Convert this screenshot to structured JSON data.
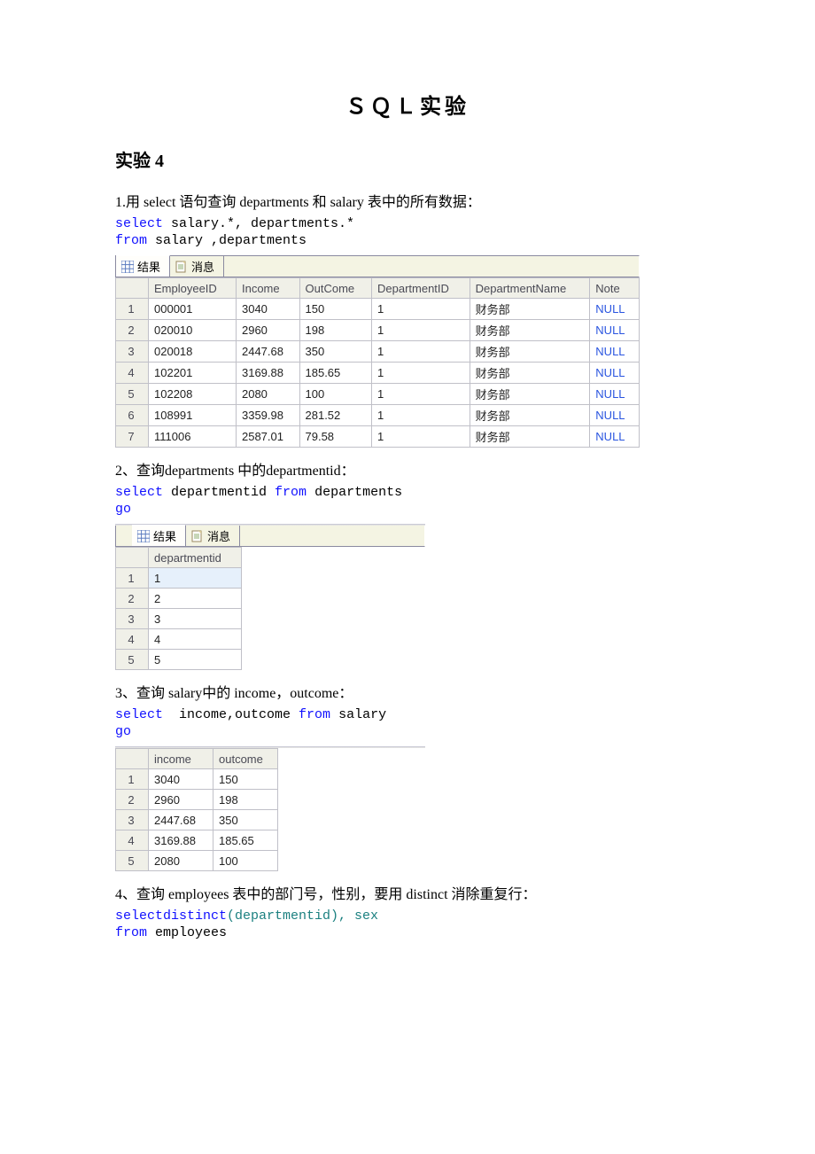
{
  "title": "ＳＱＬ实验",
  "section_heading": "实验 4",
  "q1": {
    "prompt": "1.用 select 语句查询 departments 和 salary 表中的所有数据：",
    "code_line1_select": "select",
    "code_line1_rest": " salary.*, departments.*",
    "code_line2_from": "from",
    "code_line2_rest": " salary ,departments",
    "tab_results": "结果",
    "tab_messages": "消息",
    "headers": [
      "EmployeeID",
      "Income",
      "OutCome",
      "DepartmentID",
      "DepartmentName",
      "Note"
    ],
    "rows": [
      [
        "000001",
        "3040",
        "150",
        "1",
        "财务部",
        "NULL"
      ],
      [
        "020010",
        "2960",
        "198",
        "1",
        "财务部",
        "NULL"
      ],
      [
        "020018",
        "2447.68",
        "350",
        "1",
        "财务部",
        "NULL"
      ],
      [
        "102201",
        "3169.88",
        "185.65",
        "1",
        "财务部",
        "NULL"
      ],
      [
        "102208",
        "2080",
        "100",
        "1",
        "财务部",
        "NULL"
      ],
      [
        "108991",
        "3359.98",
        "281.52",
        "1",
        "财务部",
        "NULL"
      ],
      [
        "111006",
        "2587.01",
        "79.58",
        "1",
        "财务部",
        "NULL"
      ]
    ]
  },
  "q2": {
    "prompt": "2、查询departments 中的departmentid：",
    "code_select": "select",
    "code_mid": " departmentid ",
    "code_from": "from",
    "code_rest": " departments",
    "code_go": "go",
    "tab_results": "结果",
    "tab_messages": "消息",
    "headers": [
      "departmentid"
    ],
    "rows": [
      [
        "1"
      ],
      [
        "2"
      ],
      [
        "3"
      ],
      [
        "4"
      ],
      [
        "5"
      ]
    ]
  },
  "q3": {
    "prompt": "3、查询 salary中的 income，outcome：",
    "code_select": "select",
    "code_mid": "  income,outcome ",
    "code_from": "from",
    "code_rest": " salary",
    "code_go": "go",
    "headers": [
      "income",
      "outcome"
    ],
    "rows": [
      [
        "3040",
        "150"
      ],
      [
        "2960",
        "198"
      ],
      [
        "2447.68",
        "350"
      ],
      [
        "3169.88",
        "185.65"
      ],
      [
        "2080",
        "100"
      ]
    ]
  },
  "q4": {
    "prompt": "4、查询 employees 表中的部门号，性别，要用 distinct 消除重复行：",
    "code_line1_a": "selectdistinct",
    "code_line1_b": "(departmentid), sex",
    "code_line2_from": "from",
    "code_line2_rest": " employees"
  }
}
